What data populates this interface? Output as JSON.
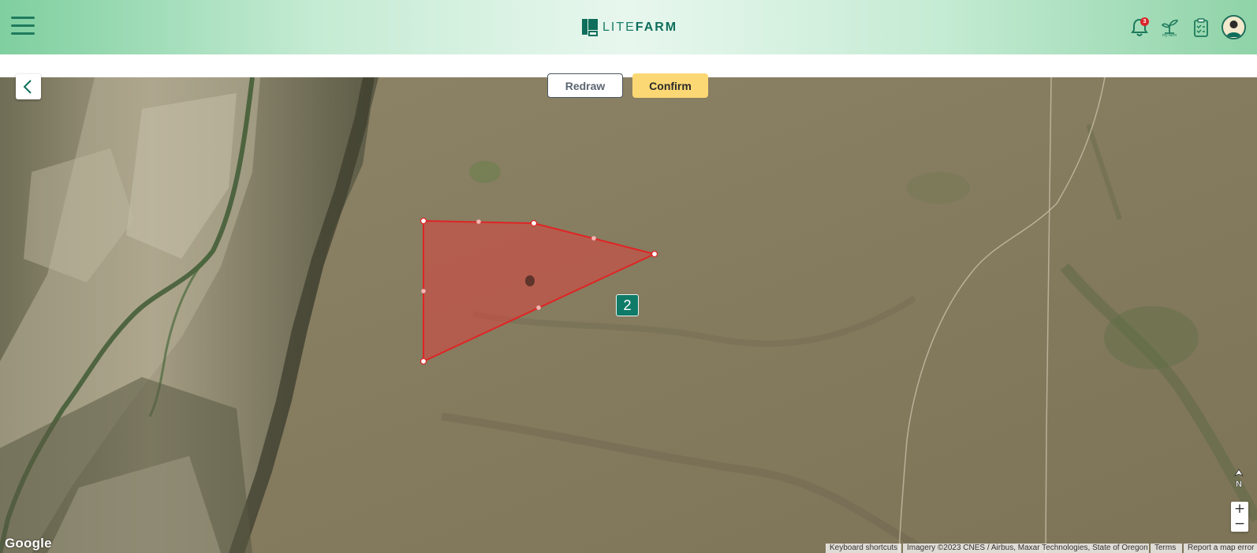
{
  "header": {
    "logo": {
      "lite": "LITE",
      "farm": "FARM"
    },
    "notification_count": "3",
    "icons": [
      "menu-icon",
      "bell-icon",
      "my-farm-icon",
      "tasks-icon",
      "avatar"
    ],
    "my_farm_label": "my farm"
  },
  "actions": {
    "redraw_label": "Redraw",
    "confirm_label": "Confirm"
  },
  "map": {
    "area_label": "2",
    "compass_label": "N",
    "zoom_in": "+",
    "zoom_out": "−",
    "google_logo": "Google",
    "attribution": {
      "keyboard": "Keyboard shortcuts",
      "imagery": "Imagery ©2023 CNES / Airbus, Maxar Technologies, State of Oregon",
      "terms": "Terms",
      "report": "Report a map error"
    }
  },
  "colors": {
    "brand": "#0f6e5b",
    "confirm": "#fcd874",
    "polygon_fill": "#d9443f",
    "polygon_stroke": "#e02424",
    "label_bg": "#0f7a68"
  }
}
